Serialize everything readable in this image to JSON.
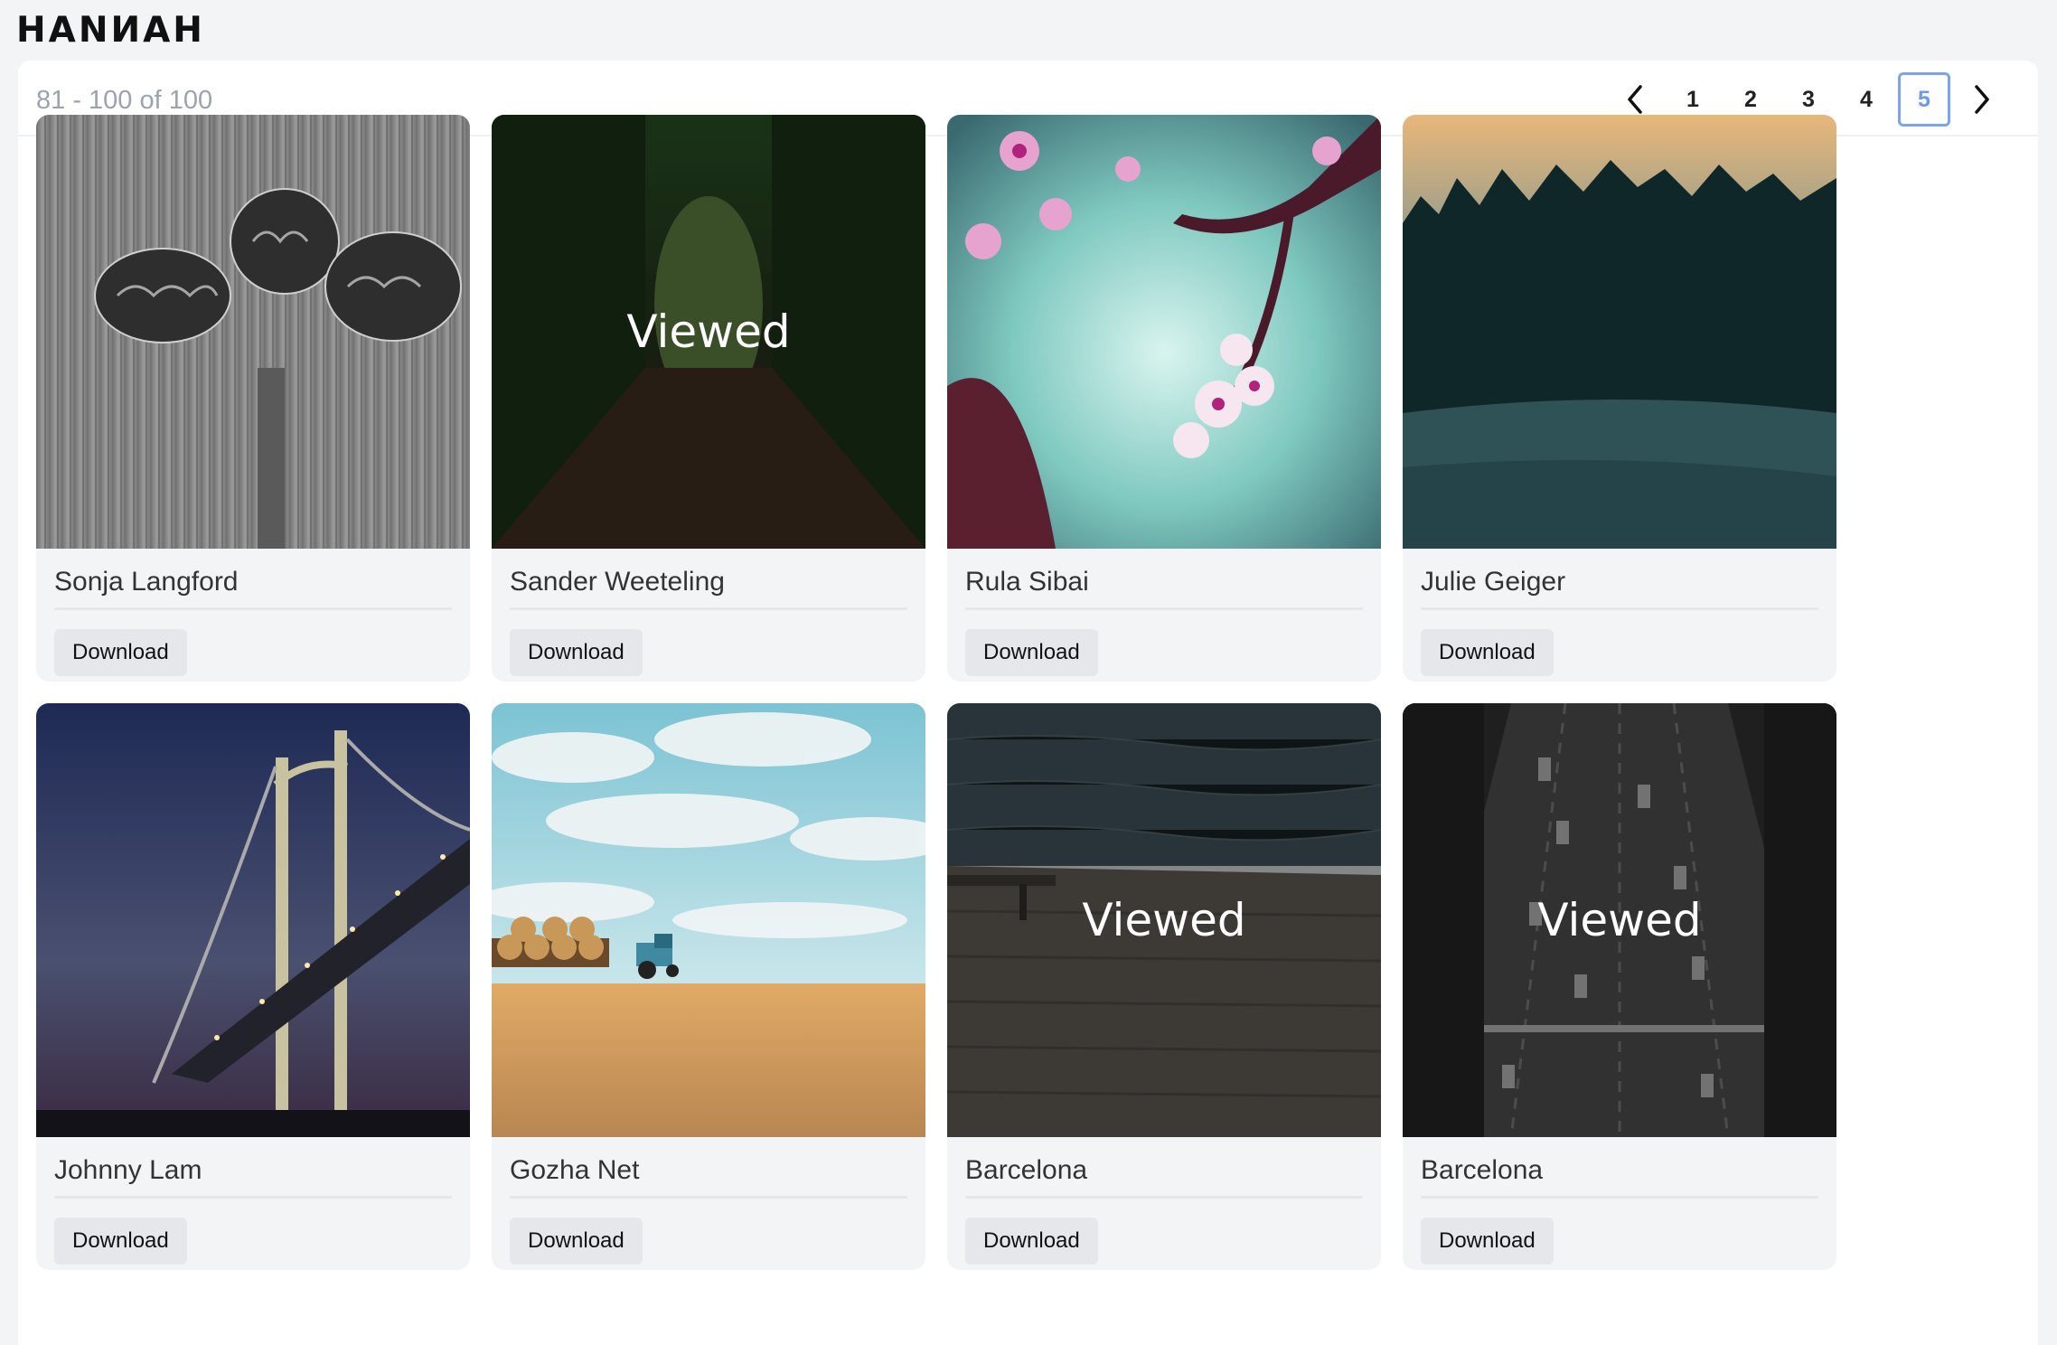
{
  "app": {
    "logo": "HANИAH"
  },
  "toolbar": {
    "range_text": "81 - 100 of 100"
  },
  "pagination": {
    "pages": [
      "1",
      "2",
      "3",
      "4",
      "5"
    ],
    "current": "5",
    "accent": "#6b9ae6"
  },
  "gallery": {
    "viewed_label": "Viewed",
    "download_label": "Download",
    "items": [
      {
        "name": "Sonja Langford",
        "viewed": false
      },
      {
        "name": "Sander Weeteling",
        "viewed": true
      },
      {
        "name": "Rula Sibai",
        "viewed": false
      },
      {
        "name": "Julie Geiger",
        "viewed": false
      },
      {
        "name": "Johnny Lam",
        "viewed": false
      },
      {
        "name": "Gozha Net",
        "viewed": false
      },
      {
        "name": "Barcelona",
        "viewed": true
      },
      {
        "name": "Barcelona",
        "viewed": true
      }
    ]
  }
}
